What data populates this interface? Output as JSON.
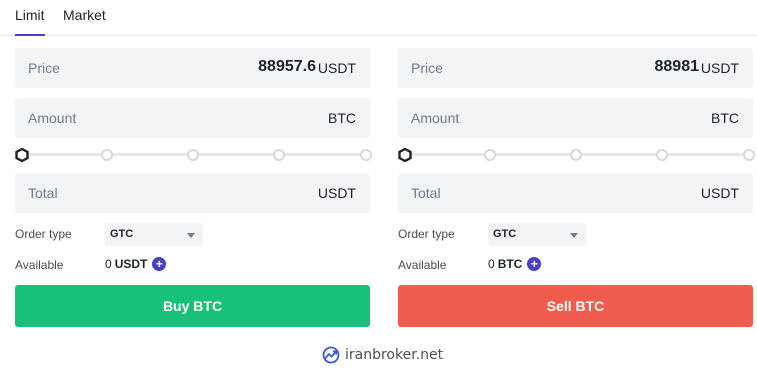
{
  "tabs": [
    {
      "label": "Limit",
      "active": true
    },
    {
      "label": "Market",
      "active": false
    }
  ],
  "buy": {
    "price_label": "Price",
    "price_value": "88957.6",
    "price_unit": "USDT",
    "amount_label": "Amount",
    "amount_unit": "BTC",
    "total_label": "Total",
    "total_unit": "USDT",
    "order_type_label": "Order type",
    "order_type_value": "GTC",
    "available_label": "Available",
    "available_value": "0",
    "available_currency": "USDT",
    "button_label": "Buy BTC"
  },
  "sell": {
    "price_label": "Price",
    "price_value": "88981",
    "price_unit": "USDT",
    "amount_label": "Amount",
    "amount_unit": "BTC",
    "total_label": "Total",
    "total_unit": "USDT",
    "order_type_label": "Order type",
    "order_type_value": "GTC",
    "available_label": "Available",
    "available_value": "0",
    "available_currency": "BTC",
    "button_label": "Sell BTC"
  },
  "slider_steps": [
    "0%",
    "25%",
    "50%",
    "75%",
    "100%"
  ],
  "slider_value_percent": 0,
  "watermark": "iranbroker.net",
  "colors": {
    "accent": "#4b3fc4",
    "buy": "#18c07a",
    "sell": "#f05d4e",
    "field_bg": "#f3f4f6"
  }
}
